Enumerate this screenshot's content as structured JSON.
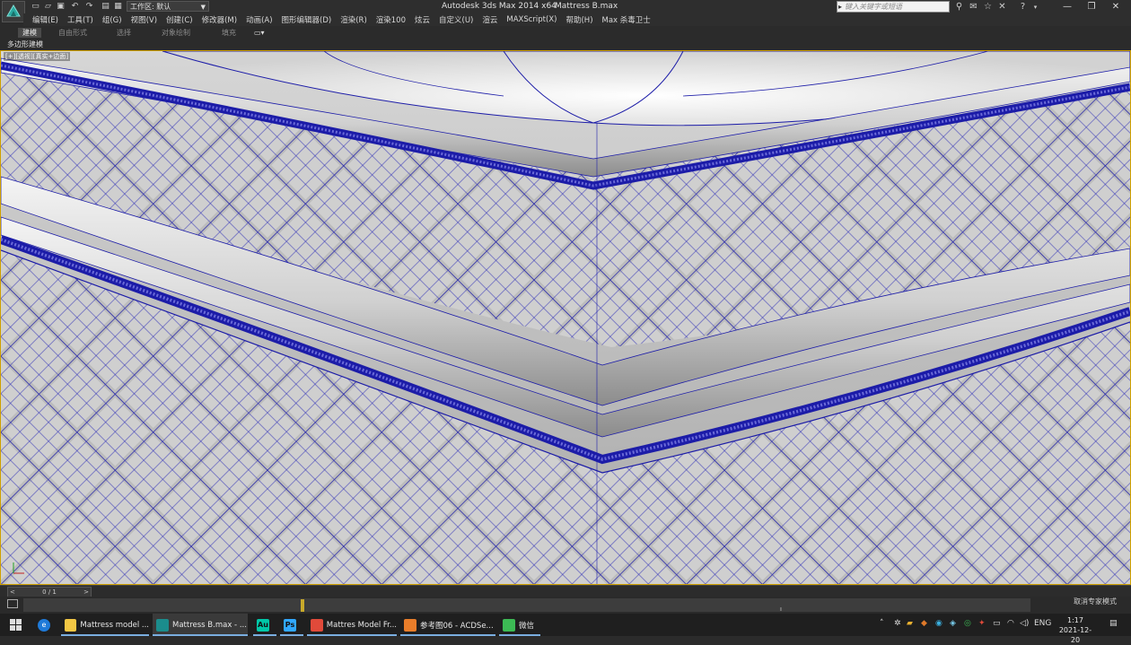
{
  "titlebar": {
    "workspace_label": "工作区: 默认",
    "app_title": "Autodesk 3ds Max  2014 x64",
    "file_title": "Mattress B.max",
    "search_placeholder": "键入关键字或短语",
    "icons": [
      "binoculars-icon",
      "star-icon",
      "help-icon"
    ],
    "window_controls": [
      "minimize-icon",
      "restore-icon",
      "close-icon"
    ]
  },
  "menubar": {
    "items": [
      "编辑(E)",
      "工具(T)",
      "组(G)",
      "视图(V)",
      "创建(C)",
      "修改器(M)",
      "动画(A)",
      "图形编辑器(D)",
      "渲染(R)",
      "渲染100",
      "炫云",
      "自定义(U)",
      "渲云",
      "MAXScript(X)",
      "帮助(H)",
      "Max 杀毒卫士"
    ]
  },
  "ribbon": {
    "tabs": [
      "建模",
      "自由形式",
      "选择",
      "对象绘制",
      "填充"
    ],
    "active_tab": "建模",
    "panel_label": "多边形建模"
  },
  "viewport": {
    "label": "[+][透视][真实+边面]",
    "mesh_color": "#1c1ca8",
    "surface_color": "#bdbdbd",
    "border_color": "#cfa000"
  },
  "timeslider": {
    "position": "0 / 1",
    "prev": "<",
    "next": ">"
  },
  "trackbar": {
    "status_text": "取消专家模式"
  },
  "taskbar": {
    "apps": [
      {
        "label": "Mattress model ...",
        "icon": "folder-icon",
        "color": "#f2c744"
      },
      {
        "label": "Mattress B.max - ...",
        "icon": "3dsmax-icon",
        "color": "#1b8c8c"
      },
      {
        "label": "Au",
        "icon": "audition-icon",
        "color": "#00c8a8"
      },
      {
        "label": "Ps",
        "icon": "photoshop-icon",
        "color": "#31a8ff"
      },
      {
        "label": "Mattres Model Fr...",
        "icon": "chrome-icon",
        "color": "#e04a3a"
      },
      {
        "label": "参考图06 - ACDSe...",
        "icon": "acdsee-icon",
        "color": "#e87d2a"
      },
      {
        "label": "微信",
        "icon": "wechat-icon",
        "color": "#3cba54"
      }
    ],
    "language": "ENG",
    "time": "1:17",
    "date": "2021-12-20"
  }
}
